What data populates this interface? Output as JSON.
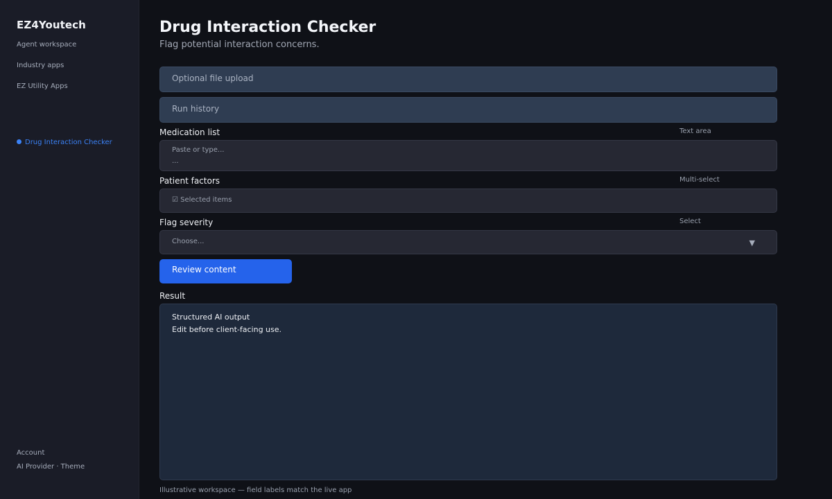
{
  "sidebar": {
    "brand": "EZ4Youtech",
    "nav": [
      "Agent workspace",
      "Industry apps",
      "EZ Utility Apps"
    ],
    "active_item": "Drug Interaction Checker",
    "footer": {
      "account": "Account",
      "settings": "AI Provider · Theme"
    }
  },
  "main": {
    "title": "Drug Interaction Checker",
    "subtitle": "Flag potential interaction concerns.",
    "upload_label": "Optional file upload",
    "history_label": "Run history",
    "fields": {
      "medication": {
        "label": "Medication list",
        "type": "Text area",
        "placeholder": "Paste or type...",
        "placeholder_more": "..."
      },
      "patient": {
        "label": "Patient factors",
        "type": "Multi-select",
        "value": "☑ Selected items"
      },
      "severity": {
        "label": "Flag severity",
        "type": "Select",
        "value": "Choose...",
        "arrow": "▼"
      }
    },
    "submit_label": "Review content",
    "result": {
      "label": "Result",
      "line1": "Structured AI output",
      "line2": "Edit before client-facing use."
    },
    "footnote": "Illustrative workspace — field labels match the live app"
  },
  "colors": {
    "accent": "#2563eb",
    "active_nav": "#3b82f6",
    "background": "#0f1117",
    "sidebar": "#1a1c27"
  }
}
